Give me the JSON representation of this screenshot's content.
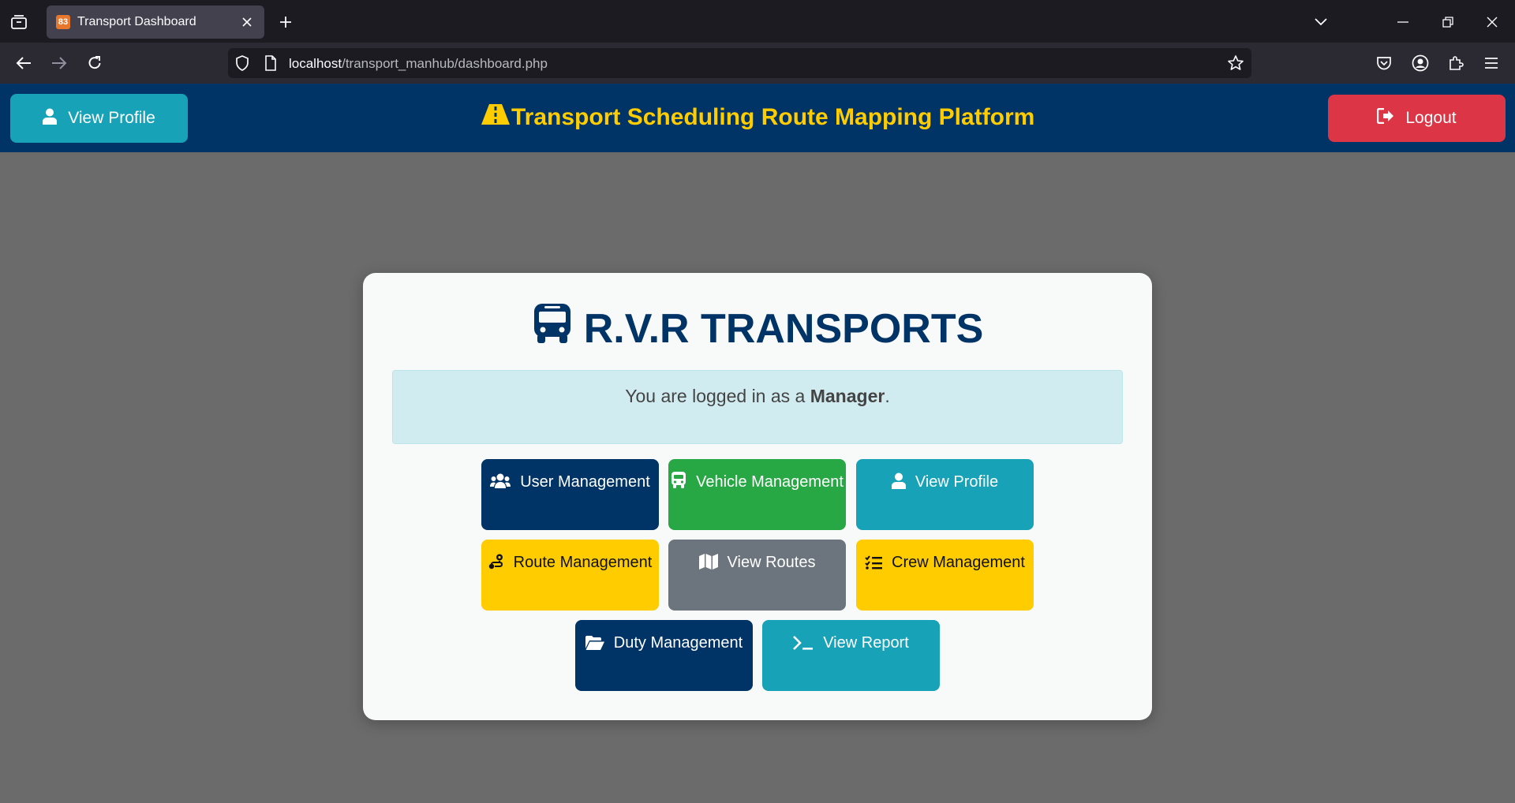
{
  "browser": {
    "tab_title": "Transport Dashboard",
    "favicon_text": "83",
    "url_host": "localhost",
    "url_path": "/transport_manhub/dashboard.php"
  },
  "header": {
    "view_profile_label": "View Profile",
    "title": "Transport Scheduling Route Mapping Platform",
    "logout_label": "Logout"
  },
  "card": {
    "brand": "R.V.R TRANSPORTS",
    "alert_prefix": "You are logged in as a ",
    "alert_role": "Manager",
    "alert_suffix": "."
  },
  "tiles": {
    "user_mgmt": "User Management",
    "vehicle_mgmt": "Vehicle Management",
    "view_profile": "View Profile",
    "route_mgmt": "Route Management",
    "view_routes": "View Routes",
    "crew_mgmt": "Crew Management",
    "duty_mgmt": "Duty Management",
    "view_report": "View Report"
  },
  "colors": {
    "navy": "#003366",
    "teal": "#17a2b8",
    "green": "#28a745",
    "yellow": "#ffcc00",
    "gray": "#6c757d",
    "red": "#dc3545"
  }
}
